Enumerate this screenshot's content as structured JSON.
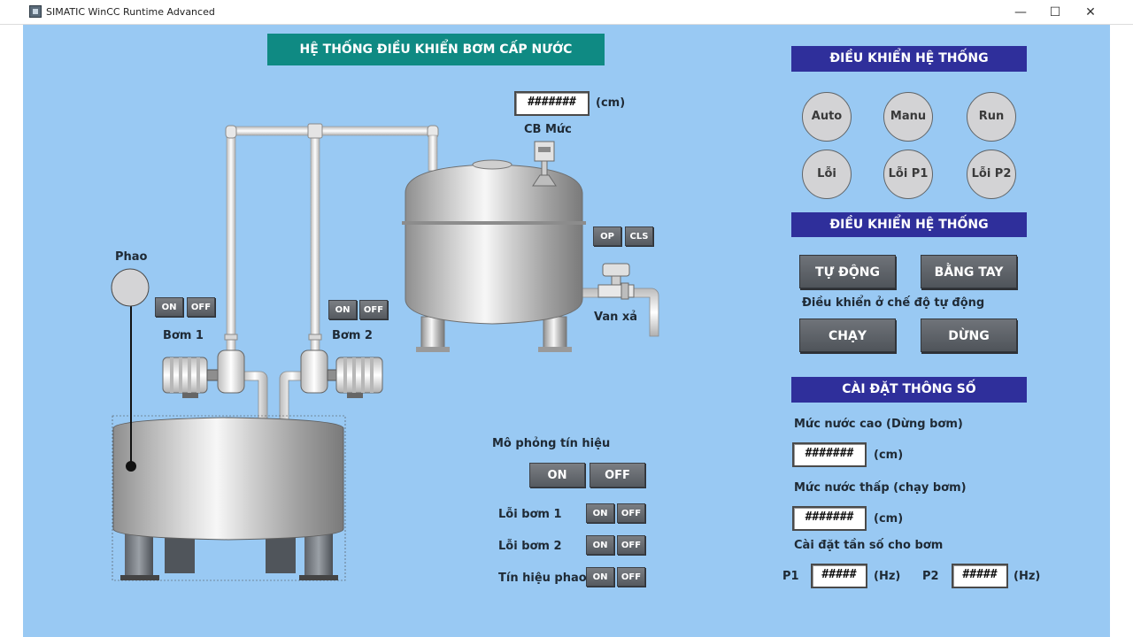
{
  "window": {
    "title": "SIMATIC WinCC Runtime Advanced",
    "min": "—",
    "max": "☐",
    "close": "✕"
  },
  "header": {
    "title": "HỆ THỐNG ĐIỀU KHIỂN BƠM CẤP NƯỚC"
  },
  "level_sensor": {
    "value": "#######",
    "unit": "(cm)",
    "label": "CB Mức"
  },
  "valve": {
    "label": "Van xả",
    "op": "OP",
    "cls": "CLS"
  },
  "float": {
    "label": "Phao"
  },
  "pump1": {
    "label": "Bơm 1",
    "on": "ON",
    "off": "OFF"
  },
  "pump2": {
    "label": "Bơm 2",
    "on": "ON",
    "off": "OFF"
  },
  "simulation": {
    "title": "Mô phỏng tín hiệu",
    "on": "ON",
    "off": "OFF",
    "rows": [
      {
        "label": "Lỗi bơm 1",
        "on": "ON",
        "off": "OFF"
      },
      {
        "label": "Lỗi bơm 2",
        "on": "ON",
        "off": "OFF"
      },
      {
        "label": "Tín hiệu phao",
        "on": "ON",
        "off": "OFF"
      }
    ]
  },
  "control1": {
    "title": "ĐIỀU KHIỂN HỆ THỐNG",
    "lamps": [
      "Auto",
      "Manu",
      "Run",
      "Lỗi",
      "Lỗi P1",
      "Lỗi P2"
    ]
  },
  "control2": {
    "title": "ĐIỀU KHIỂN HỆ THỐNG",
    "auto": "TỰ ĐỘNG",
    "manual": "BẰNG TAY",
    "note": "Điều khiển ở chế độ tự động",
    "run": "CHẠY",
    "stop": "DỪNG"
  },
  "settings": {
    "title": "CÀI ĐẶT THÔNG SỐ",
    "high_label": "Mức nước cao (Dừng bơm)",
    "high_value": "#######",
    "high_unit": "(cm)",
    "low_label": "Mức nước thấp (chạy bơm)",
    "low_value": "#######",
    "low_unit": "(cm)",
    "freq_label": "Cài đặt tần số cho bơm",
    "p1_label": "P1",
    "p1_value": "#####",
    "p1_unit": "(Hz)",
    "p2_label": "P2",
    "p2_value": "#####",
    "p2_unit": "(Hz)"
  },
  "colors": {
    "background": "#99c9f3",
    "title_teal": "#0f8a83",
    "banner_navy": "#2f2f9b"
  }
}
